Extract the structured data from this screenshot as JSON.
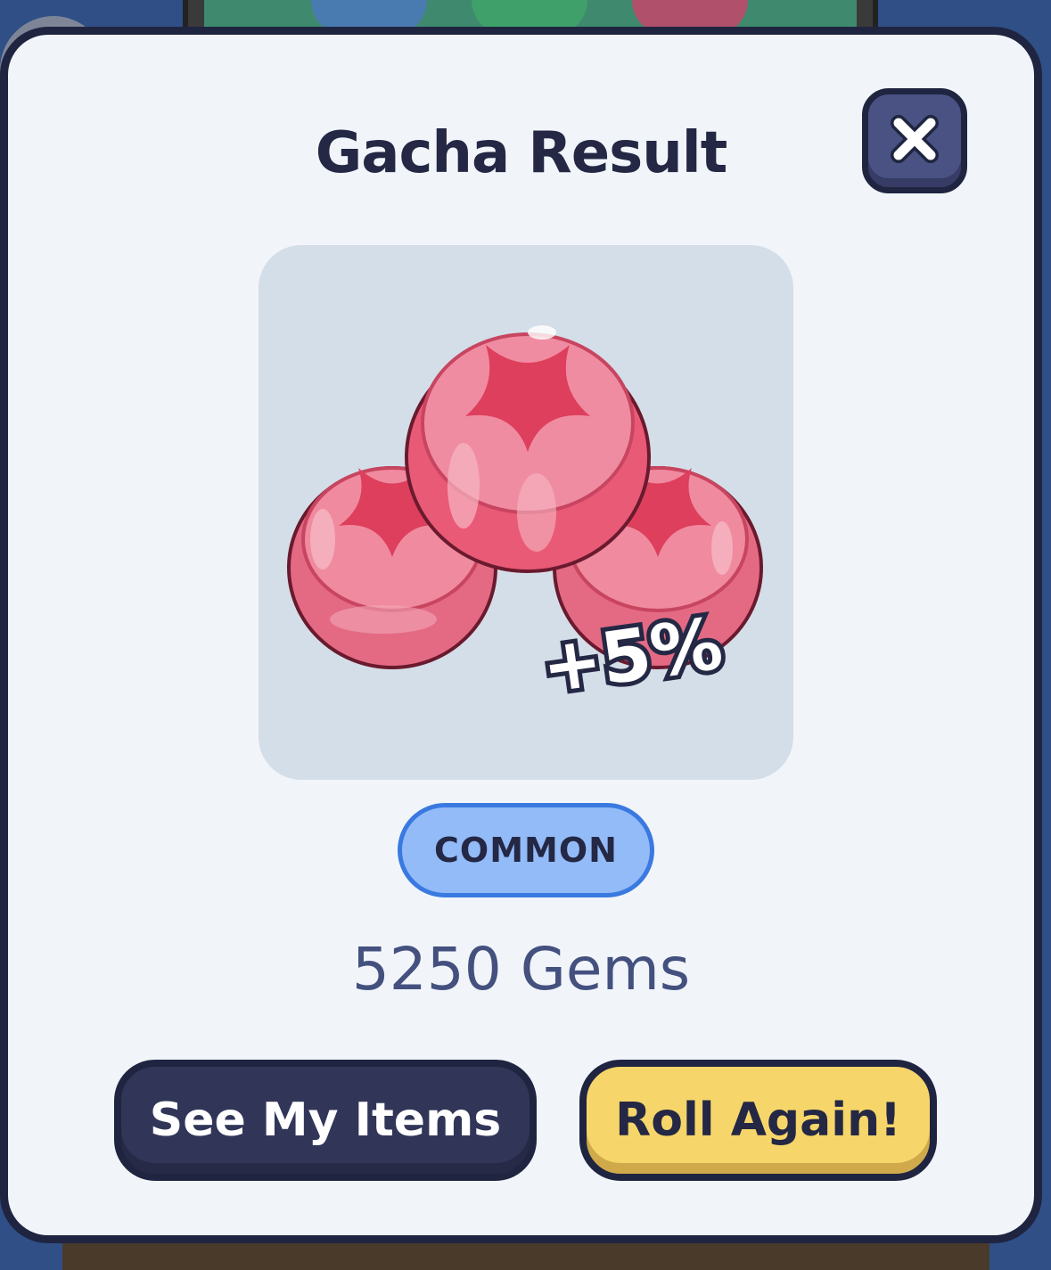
{
  "modal": {
    "title": "Gacha Result",
    "close_icon": "close-icon"
  },
  "reward": {
    "icon": "gem-candies-icon",
    "bonus_label": "+5%",
    "rarity": "COMMON",
    "amount_text": "5250 Gems"
  },
  "actions": {
    "see_items_label": "See My Items",
    "roll_again_label": "Roll Again!"
  },
  "colors": {
    "rarity_common": "#93bbf8",
    "primary_button": "#313659",
    "accent_button": "#f6d66a"
  }
}
